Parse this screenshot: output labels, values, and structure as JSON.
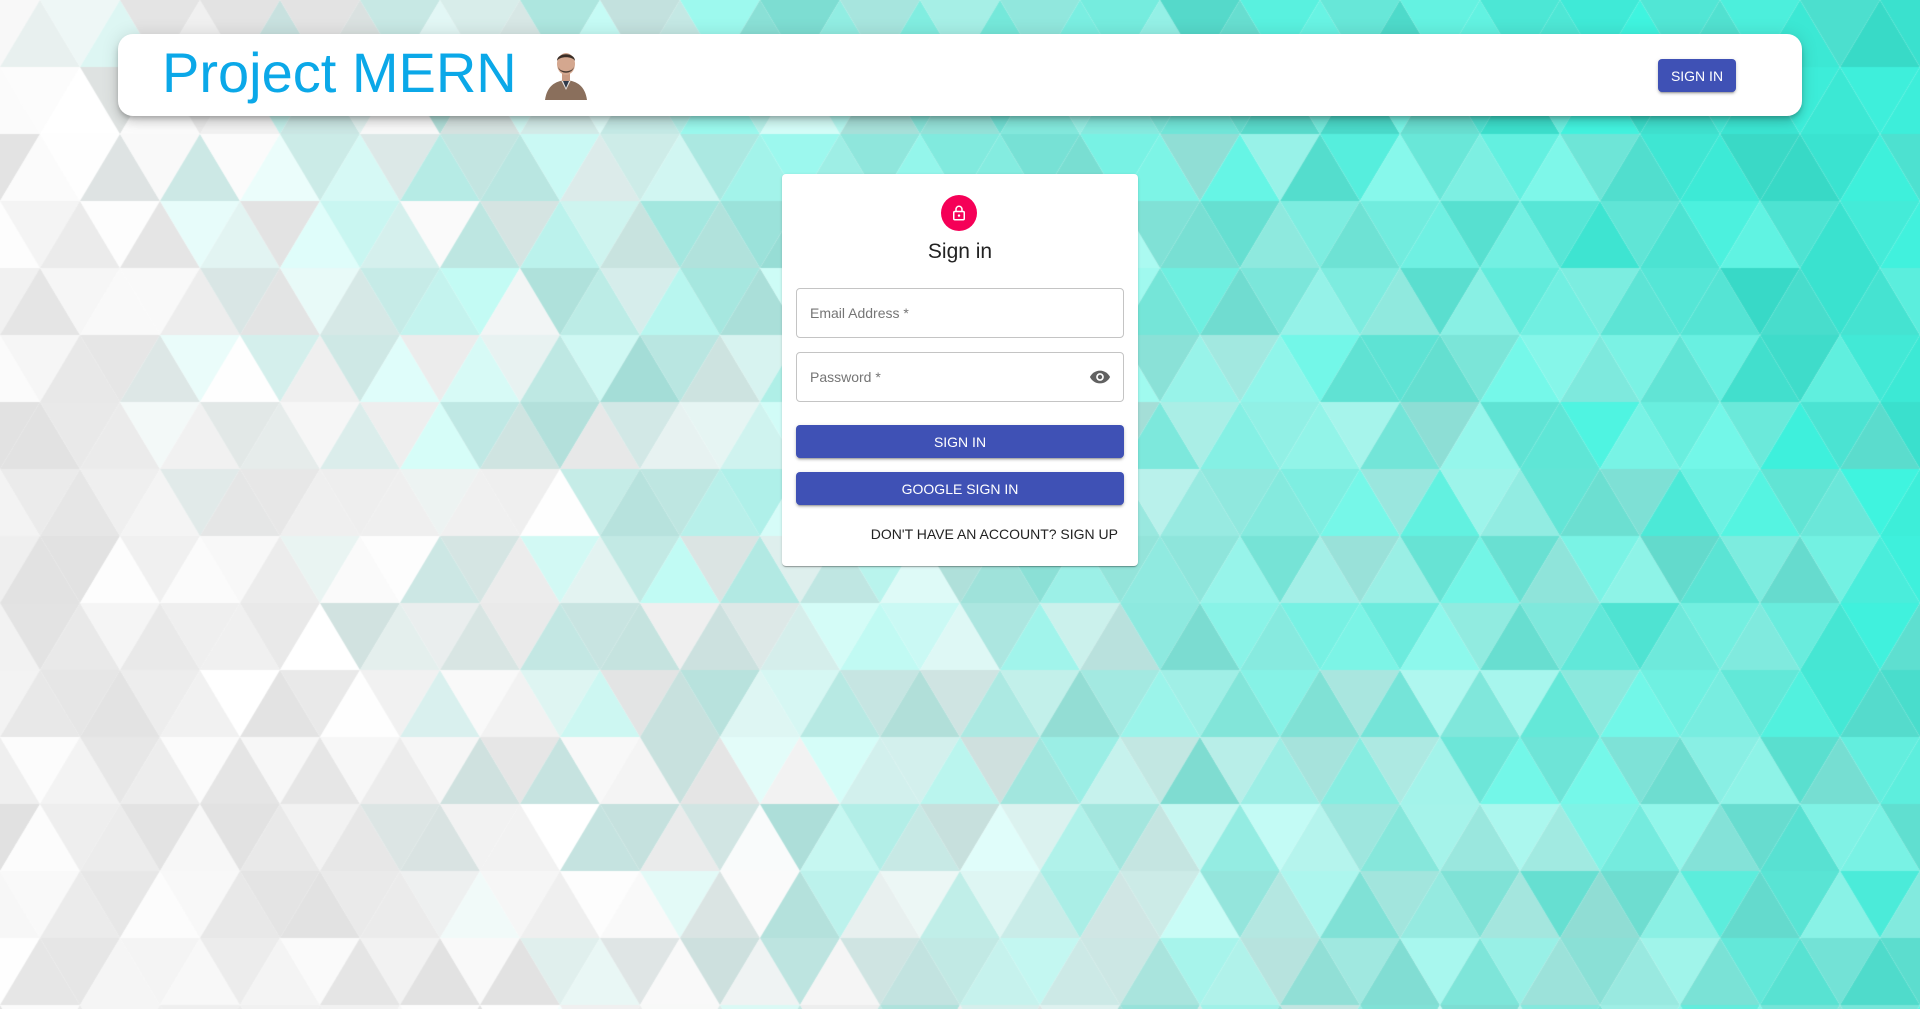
{
  "colors": {
    "brand_title": "#0ba8e8",
    "primary_button": "#3f51b5",
    "lock_avatar": "#f50057",
    "background_light": "#ffffff",
    "background_accent": "#3ff5e0"
  },
  "header": {
    "title": "Project MERN",
    "avatar_icon": "person-portrait-icon",
    "signin_label": "SIGN IN"
  },
  "signin_card": {
    "icon": "lock-icon",
    "title": "Sign in",
    "email_label": "Email Address *",
    "password_label": "Password *",
    "password_toggle_icon": "eye-icon",
    "signin_button": "SIGN IN",
    "google_button": "GOOGLE SIGN IN",
    "signup_link": "DON'T HAVE AN ACCOUNT? SIGN UP"
  }
}
